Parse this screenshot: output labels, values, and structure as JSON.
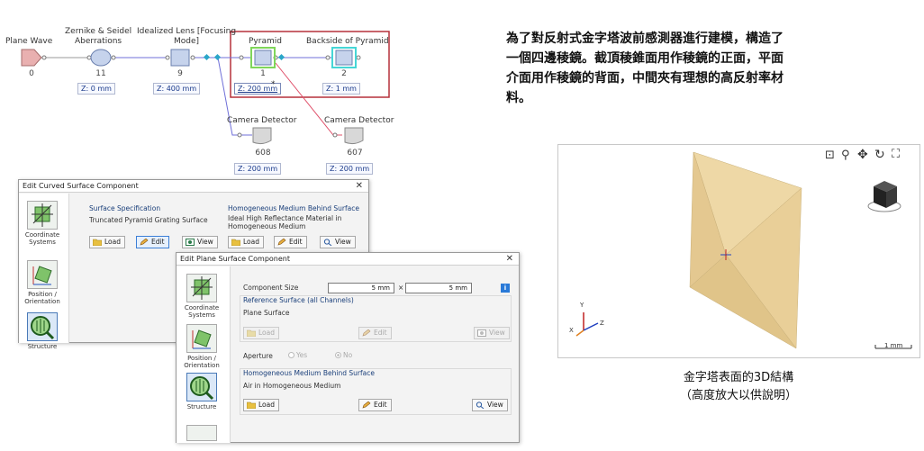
{
  "flow": {
    "nodes": [
      {
        "label": "Plane Wave",
        "num": "0"
      },
      {
        "label": "Zernike & Seidel\nAberrations",
        "num": "11",
        "z": "Z: 0 mm"
      },
      {
        "label": "Idealized Lens [Focusing\nMode]",
        "num": "9",
        "z": "Z: 400 mm"
      },
      {
        "label": "Pyramid",
        "num": "1",
        "z": "Z: 200 mm"
      },
      {
        "label": "Backside of Pyramid",
        "num": "2",
        "z": "Z: 1 mm"
      },
      {
        "label": "Camera Detector",
        "num": "608",
        "z": "Z: 200 mm"
      },
      {
        "label": "Camera Detector",
        "num": "607",
        "z": "Z: 200 mm"
      }
    ],
    "asterisk": "*"
  },
  "dialog_curved": {
    "title": "Edit Curved Surface Component",
    "close": "✕",
    "sidebar": [
      "Coordinate\nSystems",
      "Position /\nOrientation",
      "Structure"
    ],
    "surface_spec_title": "Surface Specification",
    "surface_spec_value": "Truncated Pyramid Grating Surface",
    "medium_title": "Homogeneous Medium Behind Surface",
    "medium_value": "Ideal High Reflectance Material in\nHomogeneous Medium",
    "buttons": {
      "load": "Load",
      "edit": "Edit",
      "view": "View"
    }
  },
  "dialog_plane": {
    "title": "Edit Plane Surface Component",
    "close": "✕",
    "sidebar": [
      "Coordinate\nSystems",
      "Position /\nOrientation",
      "Structure"
    ],
    "component_size_label": "Component Size",
    "size_x": "5 mm",
    "size_sep": "×",
    "size_y": "5 mm",
    "ref_surface_title": "Reference Surface (all Channels)",
    "ref_surface_value": "Plane Surface",
    "aperture_label": "Aperture",
    "aperture_yes": "Yes",
    "aperture_no": "No",
    "medium_title": "Homogeneous Medium Behind Surface",
    "medium_value": "Air in Homogeneous Medium",
    "buttons": {
      "load": "Load",
      "edit": "Edit",
      "view": "View"
    },
    "info": "i"
  },
  "description": {
    "lines": [
      "為了對反射式金字塔波前感測器進行建模，構造了",
      "一個四邊稜鏡。截頂稜錐面用作稜鏡的正面，平面",
      "介面用作稜鏡的背面，中間夾有理想的高反射率材",
      "料。"
    ]
  },
  "viewer": {
    "toolbar_icons": [
      "zoom-fit-icon",
      "zoom-icon",
      "pan-icon",
      "rotate-icon",
      "fullscreen-icon"
    ],
    "scale_label": "1 mm",
    "axis_y": "Y",
    "axis_z": "Z",
    "axis_x": "X"
  },
  "caption": {
    "line1": "金字塔表面的3D結構",
    "line2": "（高度放大以供說明）"
  },
  "colors": {
    "pyramid_face": "#e9cf98",
    "highlight_frame": "#b5303a",
    "link_blue": "#6f6fd8",
    "link_red": "#e0506a"
  }
}
